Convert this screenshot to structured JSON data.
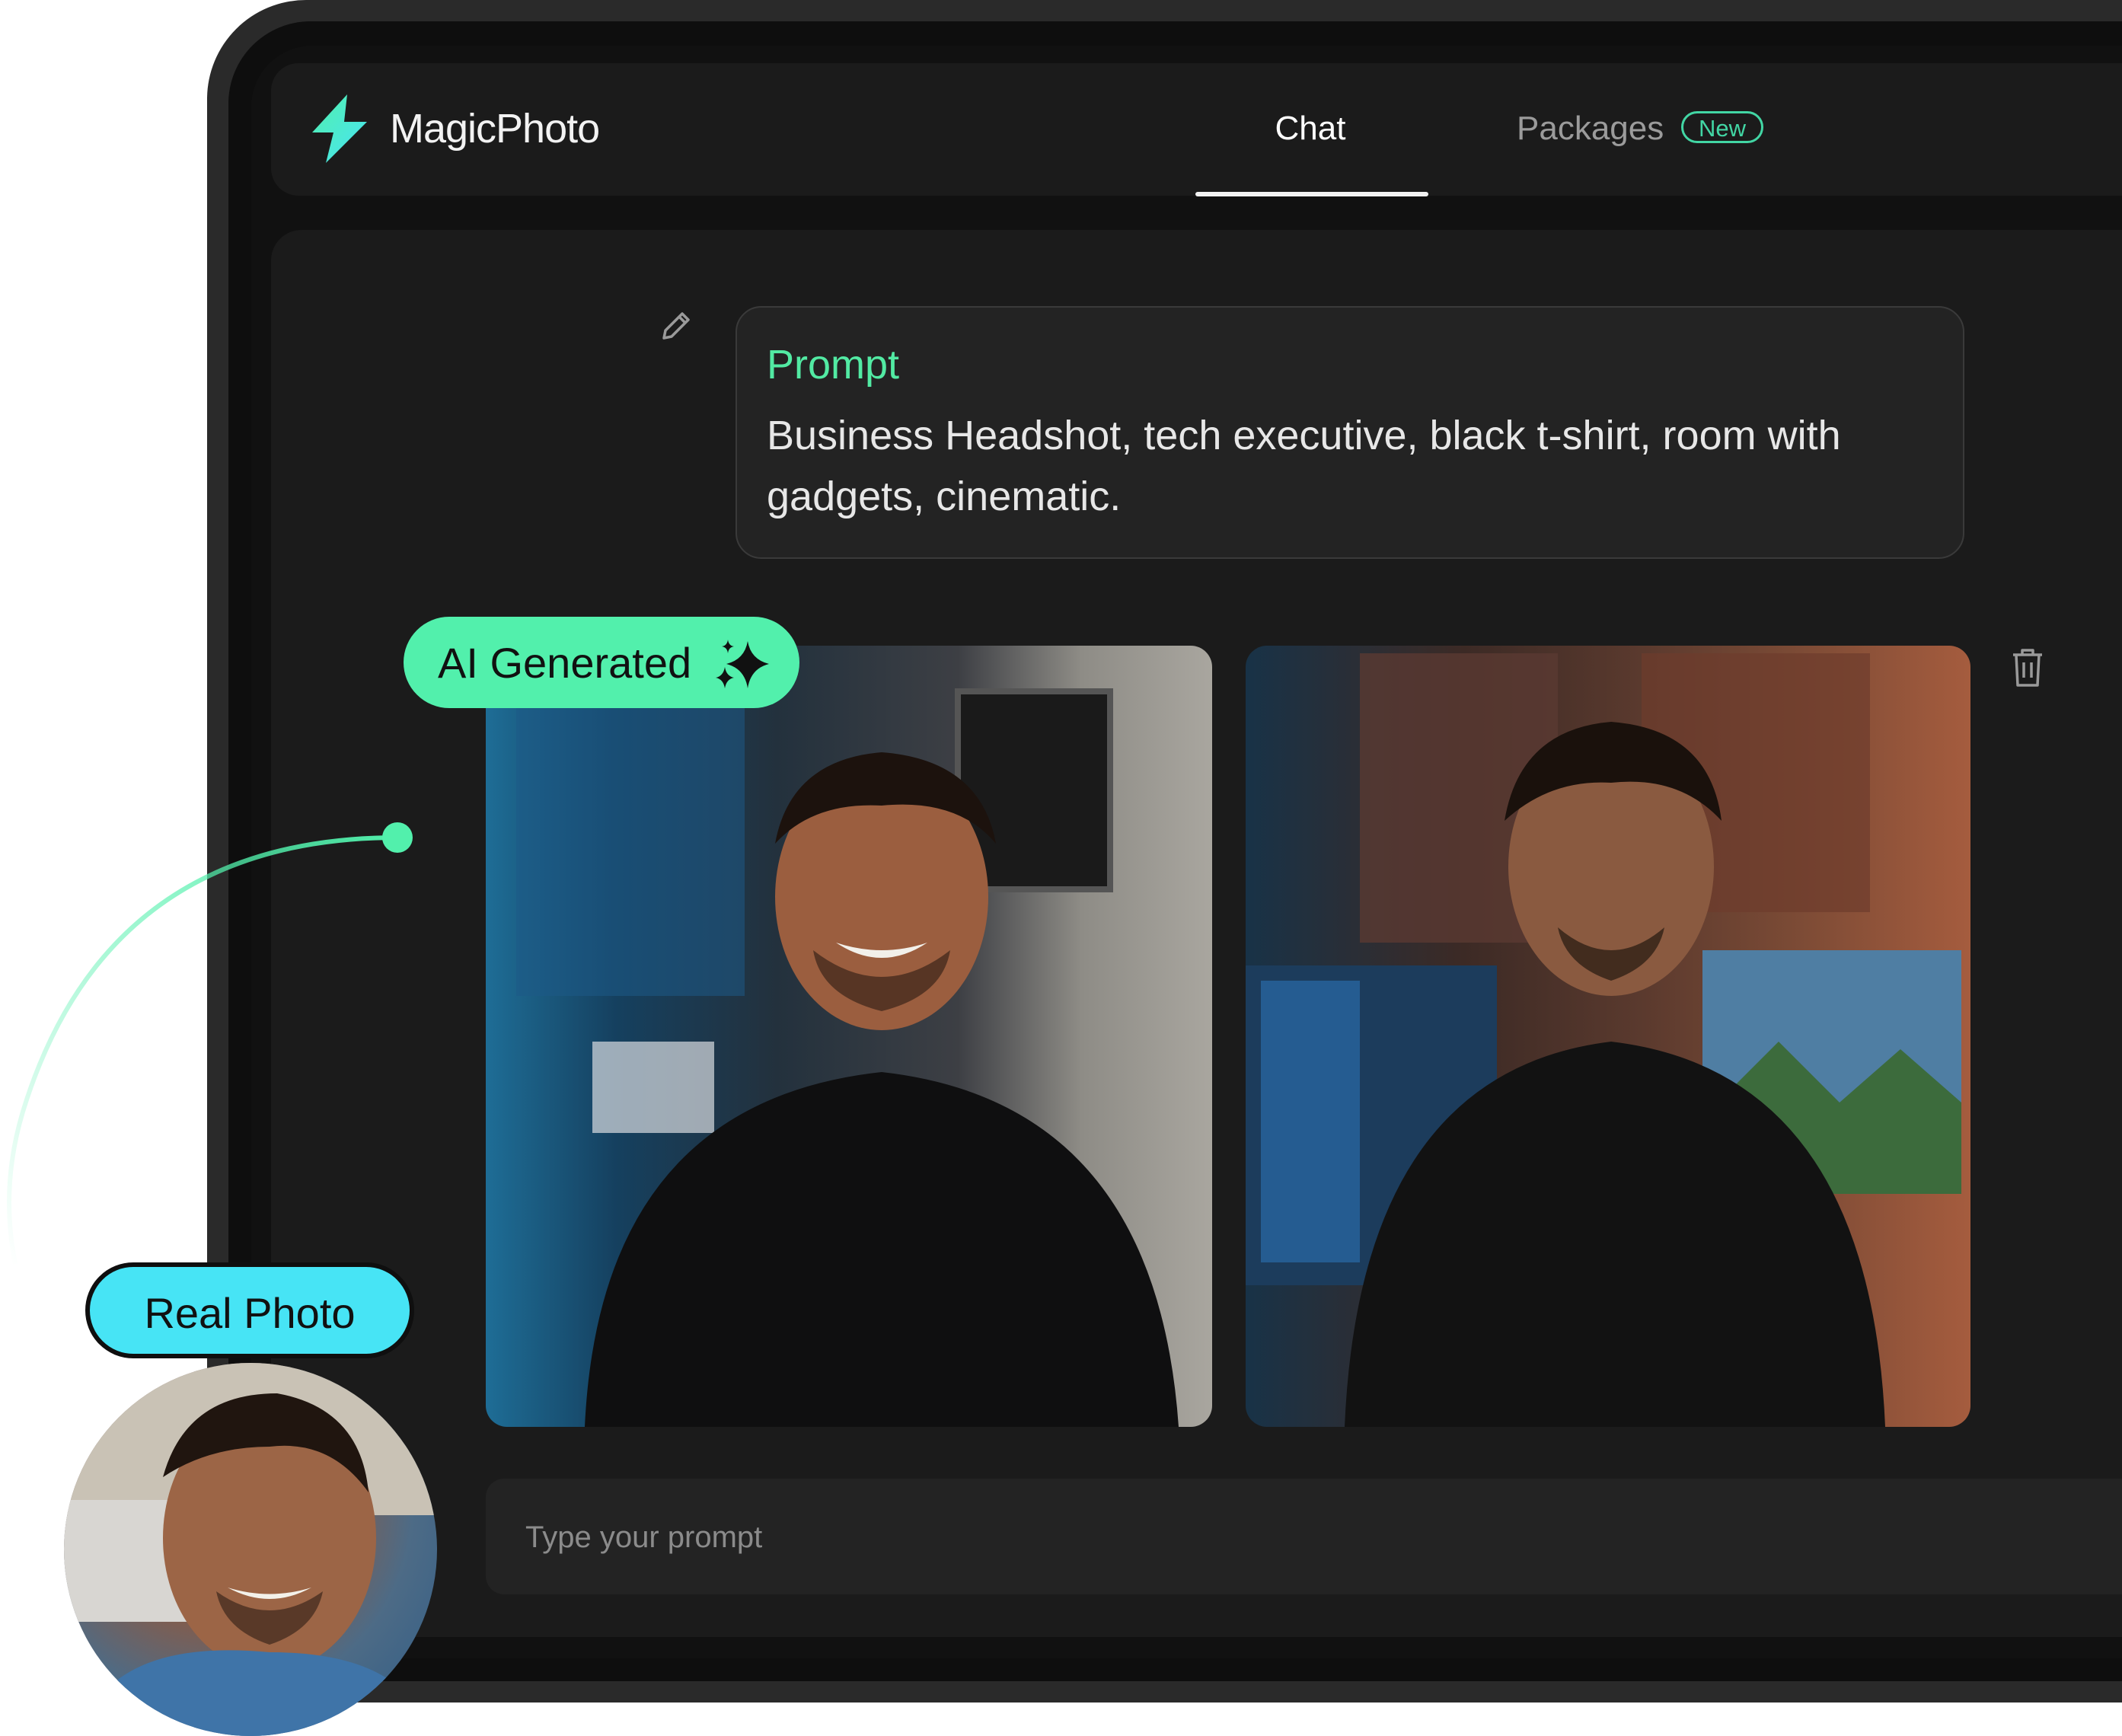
{
  "app": {
    "brand": "MagicPhoto",
    "logo_icon": "lightning-bolt-icon",
    "accent_green": "#52f0ac",
    "accent_cyan": "#47e4f5"
  },
  "nav": {
    "tabs": [
      {
        "label": "Chat",
        "active": true
      },
      {
        "label": "Packages",
        "active": false,
        "badge": "New"
      }
    ]
  },
  "chat": {
    "prompt": {
      "label": "Prompt",
      "text": "Business Headshot, tech executive, black t-shirt, room with gadgets, cinematic."
    },
    "ai_badge": "AI Generated",
    "input": {
      "placeholder": "Type your prompt"
    }
  },
  "real_photo": {
    "label": "Real Photo"
  }
}
